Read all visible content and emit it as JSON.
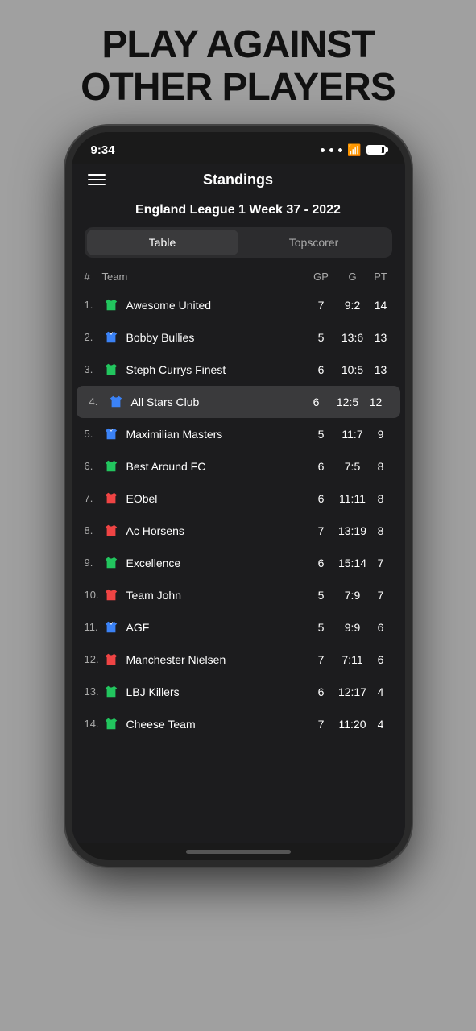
{
  "headline": {
    "line1": "PLAY AGAINST",
    "line2": "OTHER PLAYERS"
  },
  "status_bar": {
    "time": "9:34",
    "battery_label": "battery"
  },
  "nav": {
    "title": "Standings",
    "hamburger_label": "menu"
  },
  "league": {
    "title": "England League 1 Week 37 - 2022"
  },
  "tabs": [
    {
      "label": "Table",
      "active": true
    },
    {
      "label": "Topscorer",
      "active": false
    }
  ],
  "table_header": {
    "hash": "#",
    "team": "Team",
    "gp": "GP",
    "g": "G",
    "pt": "PT"
  },
  "rows": [
    {
      "num": "1.",
      "name": "Awesome United",
      "shirt_color": "#22c55e",
      "shirt_type": "plain",
      "gp": "7",
      "g": "9:2",
      "pt": "14",
      "highlighted": false
    },
    {
      "num": "2.",
      "name": "Bobby Bullies",
      "shirt_color": "#3b82f6",
      "shirt_type": "v",
      "gp": "5",
      "g": "13:6",
      "pt": "13",
      "highlighted": false
    },
    {
      "num": "3.",
      "name": "Steph Currys Finest",
      "shirt_color": "#22c55e",
      "shirt_type": "plain",
      "gp": "6",
      "g": "10:5",
      "pt": "13",
      "highlighted": false
    },
    {
      "num": "4.",
      "name": "All Stars Club",
      "shirt_color": "#3b82f6",
      "shirt_type": "plain",
      "gp": "6",
      "g": "12:5",
      "pt": "12",
      "highlighted": true
    },
    {
      "num": "5.",
      "name": "Maximilian Masters",
      "shirt_color": "#3b82f6",
      "shirt_type": "v",
      "gp": "5",
      "g": "11:7",
      "pt": "9",
      "highlighted": false
    },
    {
      "num": "6.",
      "name": "Best Around FC",
      "shirt_color": "#22c55e",
      "shirt_type": "plain",
      "gp": "6",
      "g": "7:5",
      "pt": "8",
      "highlighted": false
    },
    {
      "num": "7.",
      "name": "EObel",
      "shirt_color": "#ef4444",
      "shirt_type": "plain",
      "gp": "6",
      "g": "11:11",
      "pt": "8",
      "highlighted": false
    },
    {
      "num": "8.",
      "name": "Ac Horsens",
      "shirt_color": "#ef4444",
      "shirt_type": "plain",
      "gp": "7",
      "g": "13:19",
      "pt": "8",
      "highlighted": false
    },
    {
      "num": "9.",
      "name": "Excellence",
      "shirt_color": "#22c55e",
      "shirt_type": "plain",
      "gp": "6",
      "g": "15:14",
      "pt": "7",
      "highlighted": false
    },
    {
      "num": "10.",
      "name": "Team John",
      "shirt_color": "#ef4444",
      "shirt_type": "plain",
      "gp": "5",
      "g": "7:9",
      "pt": "7",
      "highlighted": false
    },
    {
      "num": "11.",
      "name": "AGF",
      "shirt_color": "#3b82f6",
      "shirt_type": "v",
      "gp": "5",
      "g": "9:9",
      "pt": "6",
      "highlighted": false
    },
    {
      "num": "12.",
      "name": "Manchester Nielsen",
      "shirt_color": "#ef4444",
      "shirt_type": "plain",
      "gp": "7",
      "g": "7:11",
      "pt": "6",
      "highlighted": false
    },
    {
      "num": "13.",
      "name": "LBJ Killers",
      "shirt_color": "#22c55e",
      "shirt_type": "plain",
      "gp": "6",
      "g": "12:17",
      "pt": "4",
      "highlighted": false
    },
    {
      "num": "14.",
      "name": "Cheese Team",
      "shirt_color": "#22c55e",
      "shirt_type": "plain",
      "gp": "7",
      "g": "11:20",
      "pt": "4",
      "highlighted": false
    }
  ]
}
